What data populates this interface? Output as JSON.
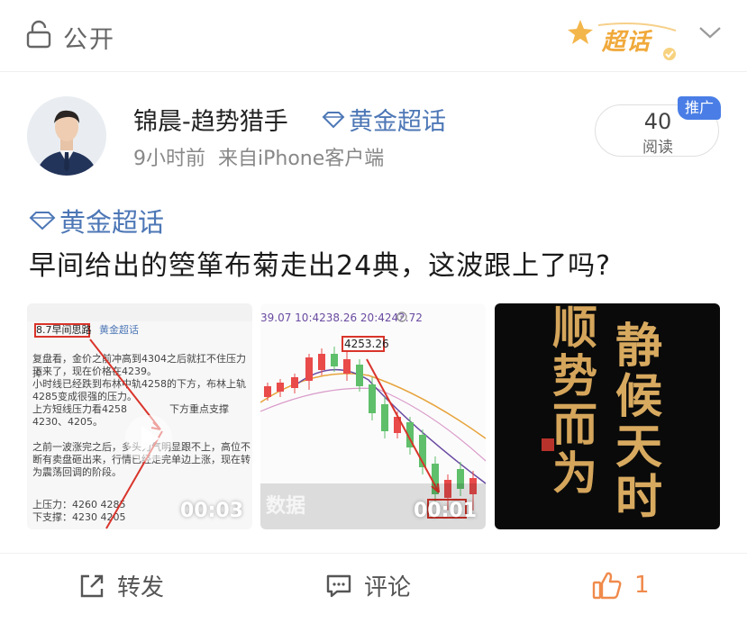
{
  "header": {
    "visibility_label": "公开",
    "supertopic_badge": "超话",
    "icons": {
      "visibility": "lock-icon",
      "collapse": "chevron-down-icon"
    }
  },
  "author": {
    "name": "锦晨-趋势猎手",
    "topic_tag": "黄金超话",
    "time": "9小时前",
    "source": "来自iPhone客户端"
  },
  "stats": {
    "reads": "40",
    "reads_label": "阅读",
    "ad_badge": "推广"
  },
  "post": {
    "topic": "黄金超话",
    "text": "早间给出的箜箪布菊走出24典，这波跟上了吗?"
  },
  "media": [
    {
      "duration": "00:03",
      "header_note": "8.7早间思路",
      "header_tag": "黄金超话",
      "lines": [
        "复盘看，金价之前冲高到4304之后就扛不住压力掉",
        "下来了，现在价格在4239。",
        "小时线已经跌到布林中轨4258的下方，布林上轨",
        "4285变成很强的压力。",
        "上方短线压力看4258",
        "4230、4205。",
        "之前一波涨完之后，多头力气明显跟不上，高位不",
        "断有卖盘砸出来，行情已经走完单边上涨，现在转",
        "为震荡回调的阶段。"
      ],
      "partial_right": "下方重点支撑",
      "resistance": "上压力：4260 4285",
      "support": "下支撑：4230 4205"
    },
    {
      "duration": "00:01",
      "top_values": "39.07  10:4238.26  20:4242.72",
      "highlight_price": "4253.26",
      "watermark": "数据"
    },
    {
      "duration": "",
      "calligraphy": [
        "顺",
        "势",
        "而",
        "为",
        "静",
        "候",
        "天",
        "时"
      ]
    }
  ],
  "actions": {
    "repost": "转发",
    "comment": "评论",
    "like_count": "1"
  },
  "colors": {
    "link_blue": "#4d77b6",
    "badge_orange": "#f0a93b",
    "ad_blue": "#4a7ee6",
    "like_orange": "#f08a4b",
    "candle_up": "#e94a4a",
    "candle_down": "#5fbf6a"
  }
}
